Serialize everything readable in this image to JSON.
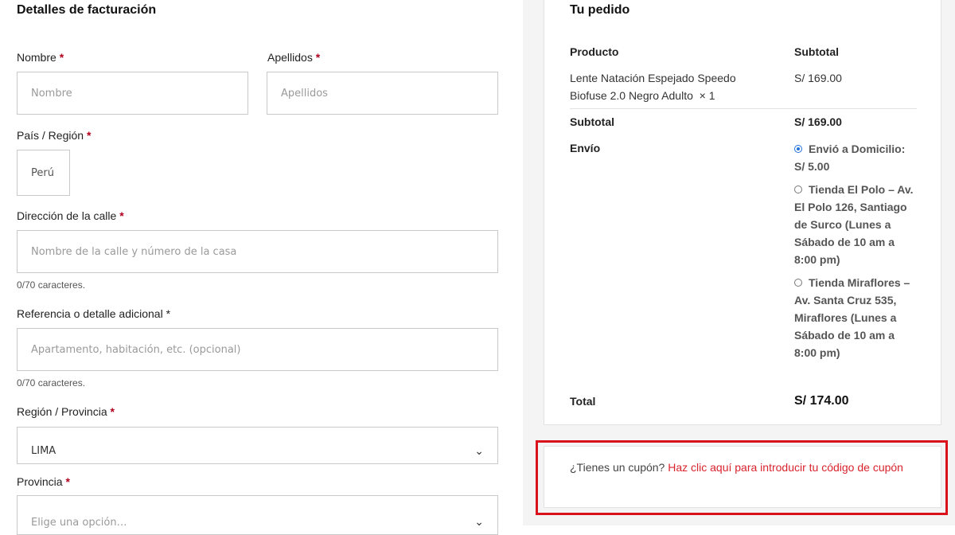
{
  "billing": {
    "title": "Detalles de facturación",
    "first_name": {
      "label": "Nombre",
      "placeholder": "Nombre"
    },
    "last_name": {
      "label": "Apellidos",
      "placeholder": "Apellidos"
    },
    "country": {
      "label": "País / Región",
      "value": "Perú"
    },
    "street": {
      "label": "Dirección de la calle",
      "placeholder": "Nombre de la calle y número de la casa",
      "counter": "0/70 caracteres."
    },
    "reference": {
      "label": "Referencia o detalle adicional",
      "placeholder": "Apartamento, habitación, etc. (opcional)",
      "counter": "0/70 caracteres."
    },
    "region": {
      "label": "Región / Provincia",
      "value": "LIMA"
    },
    "province": {
      "label": "Provincia",
      "value": "Elige una opción…"
    },
    "required_mark": "*"
  },
  "order": {
    "title": "Tu pedido",
    "col_product": "Producto",
    "col_subtotal": "Subtotal",
    "item_name": "Lente Natación Espejado Speedo Biofuse 2.0 Negro Adulto",
    "item_qty": "× 1",
    "item_price": "S/ 169.00",
    "subtotal_label": "Subtotal",
    "subtotal_value": "S/ 169.00",
    "shipping_label": "Envío",
    "shipping_options": [
      {
        "label": "Envió a Domicilio: S/ 5.00",
        "selected": true
      },
      {
        "label": "Tienda El Polo – Av. El Polo 126, Santiago de Surco (Lunes a Sábado de 10 am a 8:00 pm)",
        "selected": false
      },
      {
        "label": "Tienda Miraflores – Av. Santa Cruz 535, Miraflores (Lunes a Sábado de 10 am a 8:00 pm)",
        "selected": false
      }
    ],
    "total_label": "Total",
    "total_value": "S/ 174.00"
  },
  "coupon": {
    "prompt": "¿Tienes un cupón?",
    "link": "Haz clic aquí para introducir tu código de cupón"
  },
  "colors": {
    "accent_red": "#d9111b",
    "radio_blue": "#2271d6",
    "required": "#b0001e"
  }
}
